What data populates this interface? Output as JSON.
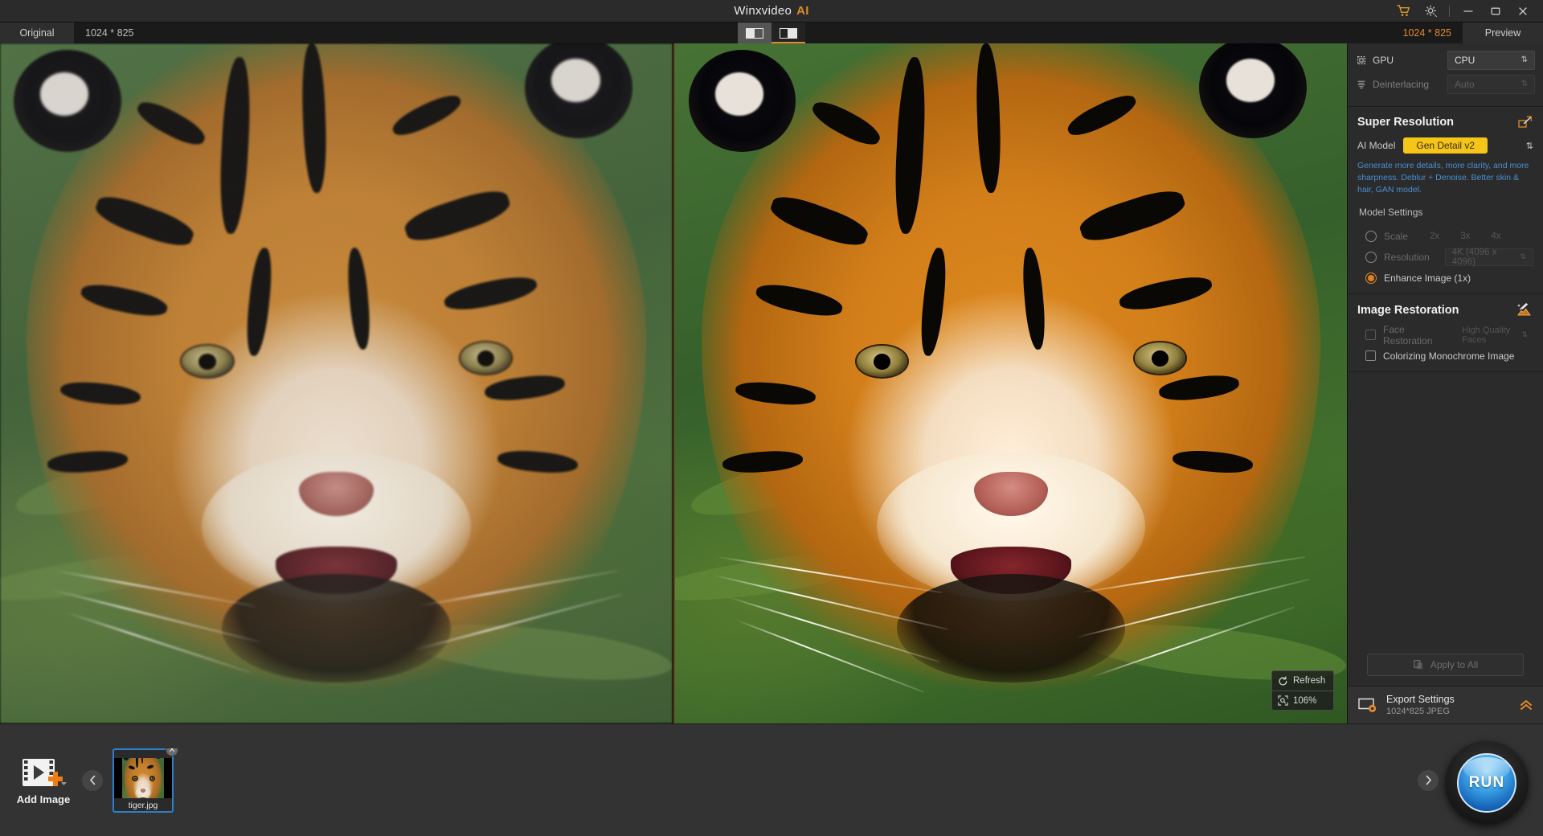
{
  "window": {
    "title": "Winxvideo",
    "title_accent": "AI",
    "controls": {
      "cart": "cart-icon",
      "settings": "gear-icon",
      "minimize": "minimize-icon",
      "maximize": "maximize-icon",
      "close": "close-icon"
    }
  },
  "tabstrip": {
    "original_tab": "Original",
    "original_resolution": "1024 * 825",
    "preview_tab": "Preview",
    "preview_resolution": "1024 * 825",
    "view_modes": [
      {
        "name": "single-view",
        "selected": false
      },
      {
        "name": "split-view",
        "selected": true
      }
    ]
  },
  "viewer": {
    "refresh_label": "Refresh",
    "zoom_level": "106%"
  },
  "sidebar": {
    "gpu": {
      "label": "GPU",
      "value": "CPU",
      "enabled": true
    },
    "deinterlacing": {
      "label": "Deinterlacing",
      "value": "Auto",
      "enabled": false
    },
    "super_resolution": {
      "title": "Super Resolution",
      "expand_icon": "expand-icon",
      "ai_model_label": "AI Model",
      "ai_model_value": "Gen Detail v2",
      "description": "Generate more details, more clarity, and more sharpness. Deblur + Denoise. Better skin & hair, GAN model.",
      "model_settings_label": "Model Settings",
      "options": [
        {
          "label": "Scale",
          "selected": false,
          "enabled": false,
          "choices": [
            "2x",
            "3x",
            "4x"
          ]
        },
        {
          "label": "Resolution",
          "selected": false,
          "enabled": false,
          "value": "4K (4096 x 4096)"
        },
        {
          "label": "Enhance Image (1x)",
          "selected": true,
          "enabled": true
        }
      ]
    },
    "image_restoration": {
      "title": "Image Restoration",
      "icon": "magic-image-icon",
      "face_restoration": {
        "label": "Face Restoration",
        "checked": false,
        "value": "High Quality Faces"
      },
      "colorizing": {
        "label": "Colorizing Monochrome Image",
        "checked": false
      }
    },
    "apply_to_all": {
      "label": "Apply to All",
      "icon": "copy-icon",
      "enabled": false
    },
    "export_settings": {
      "title": "Export Settings",
      "details": "1024*825  JPEG",
      "icon": "export-gear-icon",
      "chevron": "chevron-up-icon"
    }
  },
  "bottom": {
    "add_image_label": "Add Image",
    "add_image_icon": "add-image-icon",
    "prev_arrow": "chevron-left-icon",
    "next_arrow": "chevron-right-icon",
    "thumbnails": [
      {
        "name": "tiger.jpg",
        "selected": true,
        "close_icon": "close-icon"
      }
    ],
    "run_label": "RUN"
  },
  "colors": {
    "accent_orange": "#e08a2e",
    "pill_yellow": "#f5c518",
    "description_blue": "#4a8fd4",
    "selection_blue": "#2f7ec9",
    "panel_bg": "#2b2b2b",
    "bottom_bg": "#333333",
    "titlebar_bg": "#2b2b2b"
  }
}
